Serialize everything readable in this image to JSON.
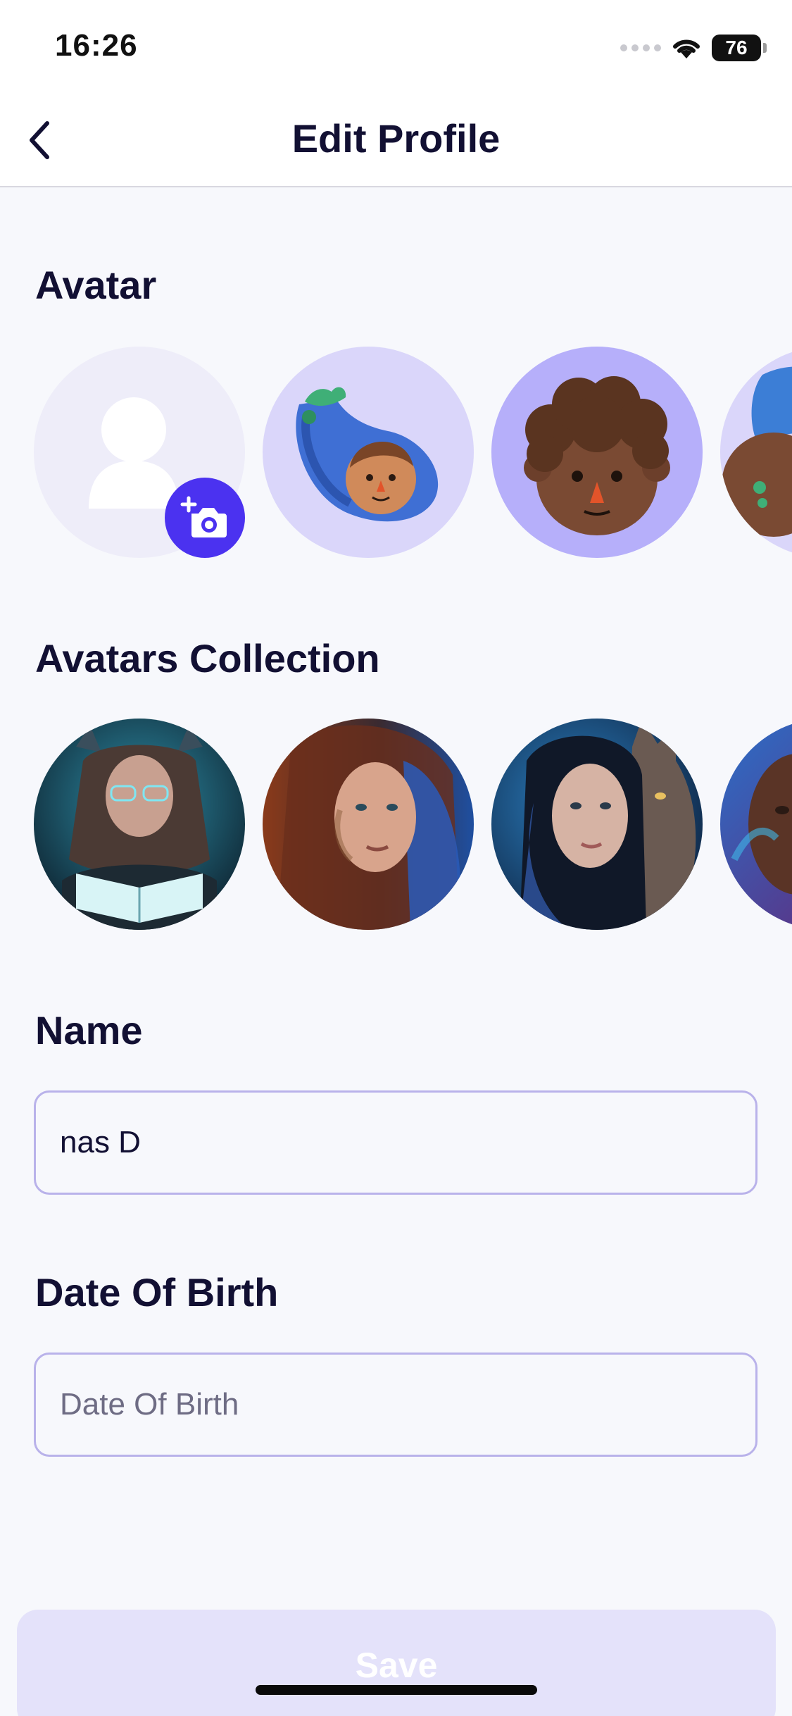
{
  "status_bar": {
    "time": "16:26",
    "battery": "76"
  },
  "header": {
    "title": "Edit Profile",
    "back_icon": "chevron-left-icon"
  },
  "avatar_section": {
    "title": "Avatar",
    "items": [
      {
        "kind": "upload",
        "icon": "person-placeholder-icon",
        "badge_icon": "add-camera-icon"
      },
      {
        "kind": "3d-avatar",
        "description": "eggplant avatar"
      },
      {
        "kind": "3d-avatar",
        "description": "curly-hair avatar",
        "selected": true
      },
      {
        "kind": "3d-avatar",
        "description": "blue-hat avatar"
      }
    ]
  },
  "collection_section": {
    "title": "Avatars Collection",
    "items": [
      {
        "description": "woman reading book portrait"
      },
      {
        "description": "woman with fiery hair portrait"
      },
      {
        "description": "woman with wolf portrait"
      },
      {
        "description": "woman cosmic portrait"
      }
    ]
  },
  "name_field": {
    "label": "Name",
    "value": "nas D",
    "placeholder": ""
  },
  "dob_field": {
    "label": "Date Of Birth",
    "value": "",
    "placeholder": "Date Of Birth"
  },
  "save_button": {
    "label": "Save"
  },
  "colors": {
    "accent": "#4B32F0",
    "title_text": "#121033",
    "disabled_button": "#E4E2FA",
    "field_border": "#B9B2EA"
  }
}
